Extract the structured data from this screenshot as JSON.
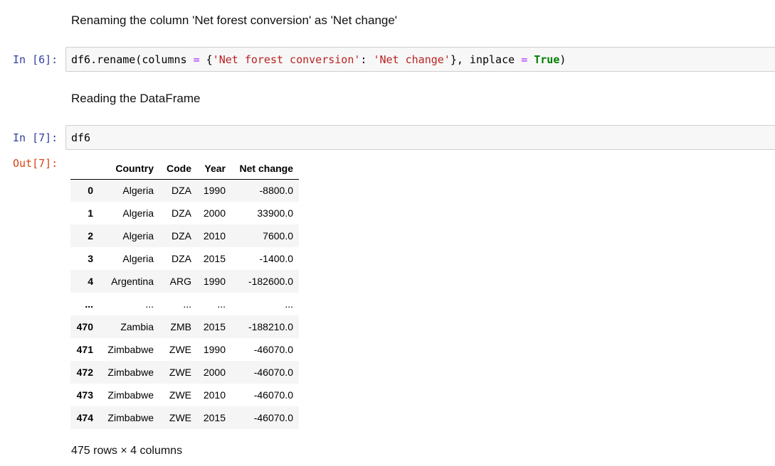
{
  "cells": {
    "md1": {
      "text": "Renaming the column 'Net forest conversion' as 'Net change'"
    },
    "code1": {
      "prompt": "In [6]:",
      "tokens": {
        "t1": "df6.rename(columns ",
        "t2": "=",
        "t3": " {",
        "t4": "'Net forest conversion'",
        "t5": ": ",
        "t6": "'Net change'",
        "t7": "}, inplace ",
        "t8": "=",
        "t9": " ",
        "t10": "True",
        "t11": ")"
      }
    },
    "md2": {
      "text": "Reading the DataFrame"
    },
    "code2": {
      "prompt": "In [7]:",
      "code": "df6"
    },
    "output": {
      "prompt": "Out[7]:",
      "table": {
        "headers": [
          "",
          "Country",
          "Code",
          "Year",
          "Net change"
        ],
        "rows": [
          [
            "0",
            "Algeria",
            "DZA",
            "1990",
            "-8800.0"
          ],
          [
            "1",
            "Algeria",
            "DZA",
            "2000",
            "33900.0"
          ],
          [
            "2",
            "Algeria",
            "DZA",
            "2010",
            "7600.0"
          ],
          [
            "3",
            "Algeria",
            "DZA",
            "2015",
            "-1400.0"
          ],
          [
            "4",
            "Argentina",
            "ARG",
            "1990",
            "-182600.0"
          ],
          [
            "...",
            "...",
            "...",
            "...",
            "..."
          ],
          [
            "470",
            "Zambia",
            "ZMB",
            "2015",
            "-188210.0"
          ],
          [
            "471",
            "Zimbabwe",
            "ZWE",
            "1990",
            "-46070.0"
          ],
          [
            "472",
            "Zimbabwe",
            "ZWE",
            "2000",
            "-46070.0"
          ],
          [
            "473",
            "Zimbabwe",
            "ZWE",
            "2010",
            "-46070.0"
          ],
          [
            "474",
            "Zimbabwe",
            "ZWE",
            "2015",
            "-46070.0"
          ]
        ]
      },
      "summary": "475 rows × 4 columns"
    }
  }
}
